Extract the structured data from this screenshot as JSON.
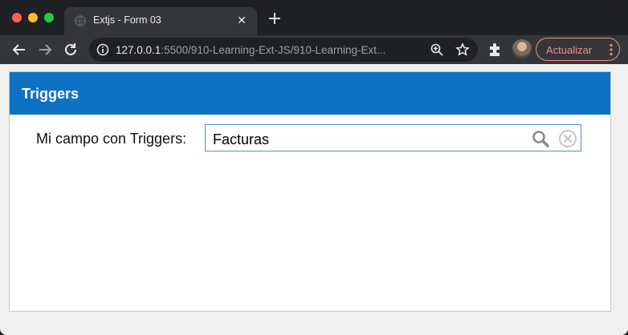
{
  "browser": {
    "tab": {
      "title": "Extjs - Form 03",
      "close_glyph": "✕"
    },
    "new_tab_glyph": "+",
    "url": {
      "host": "127.0.0.1",
      "rest": ":5500/910-Learning-Ext-JS/910-Learning-Ext..."
    },
    "update_button": "Actualizar"
  },
  "panel": {
    "title": "Triggers",
    "field": {
      "label": "Mi campo con Triggers:",
      "value": "Facturas"
    }
  },
  "colors": {
    "panel_header": "#0e72c4",
    "field_border": "#4a8fcf",
    "update_accent": "#f28b82"
  },
  "icons": [
    "globe-icon",
    "close-icon",
    "plus-icon",
    "back-arrow-icon",
    "forward-arrow-icon",
    "reload-icon",
    "info-icon",
    "zoom-icon",
    "star-icon",
    "puzzle-icon",
    "avatar",
    "kebab-menu-icon",
    "search-icon",
    "clear-icon"
  ]
}
